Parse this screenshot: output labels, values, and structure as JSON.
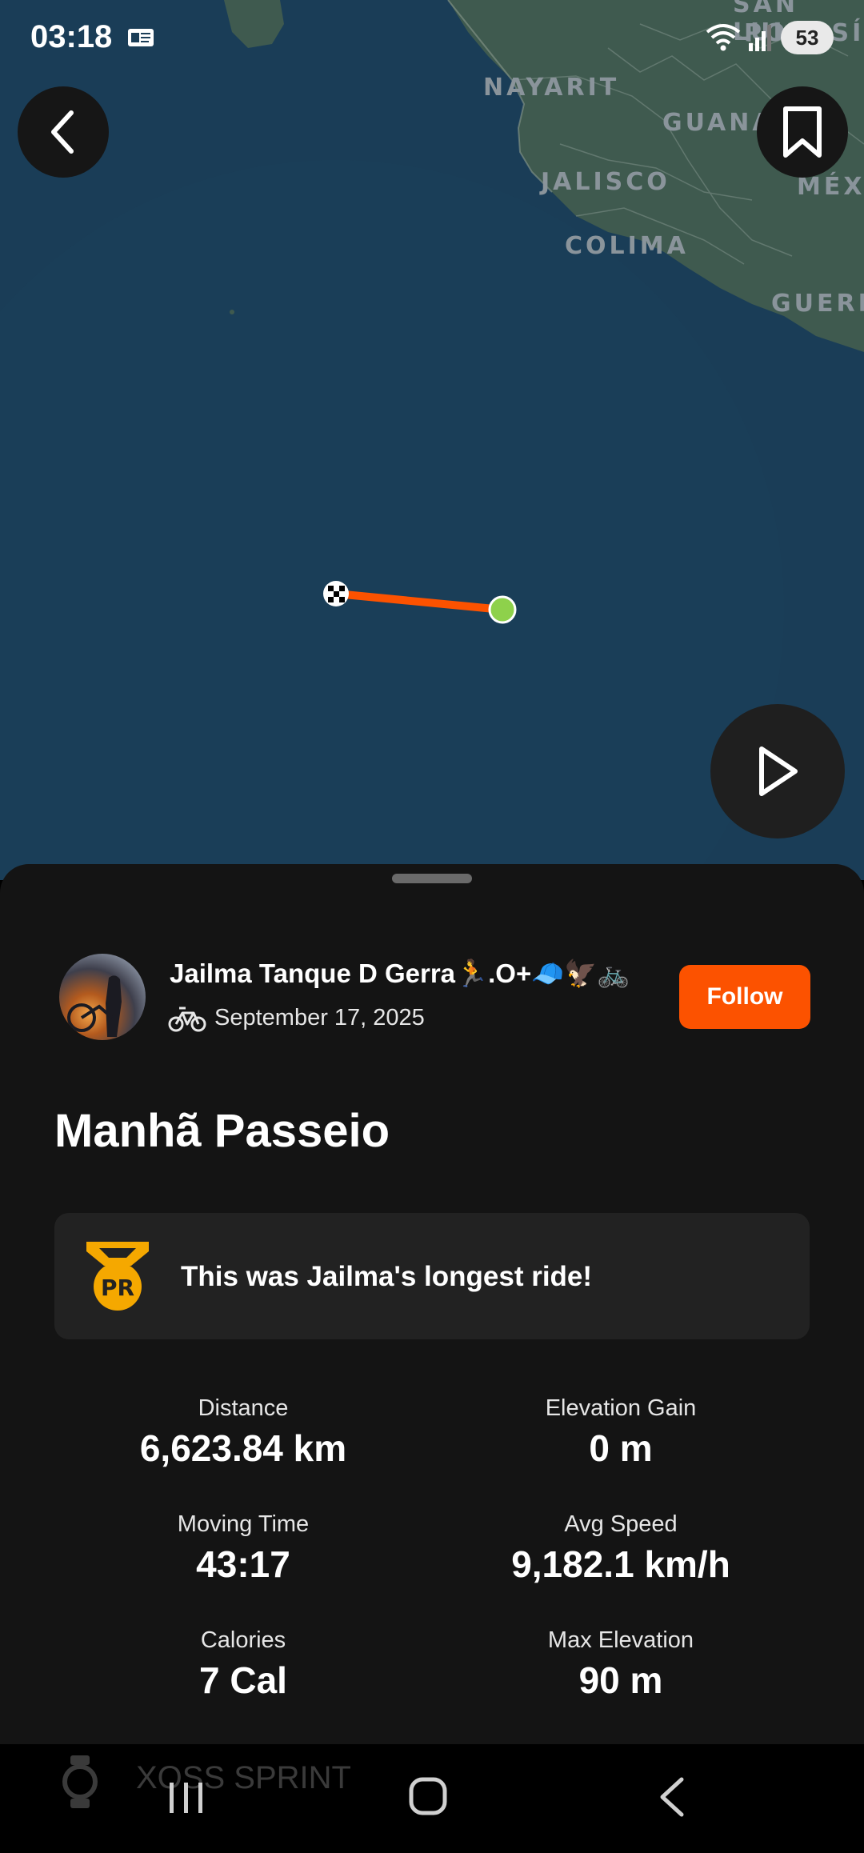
{
  "status_bar": {
    "time": "03:18",
    "battery": "53"
  },
  "map": {
    "labels": {
      "nayarit": "NAYARIT",
      "jalisco": "JALISCO",
      "colima": "COLIMA",
      "guanajuato": "GUANA",
      "mexico": "MÉX",
      "guerrero": "GUERR",
      "san_luis": "SAN LUIS",
      "potosi": "POTOSÍ"
    }
  },
  "activity": {
    "athlete_name": "Jailma Tanque  D Gerra🏃.O+🧢🦅🚲",
    "date": "September 17, 2025",
    "follow_label": "Follow",
    "title": "Manhã Passeio",
    "pr_message": "This was Jailma's longest ride!",
    "pr_badge": "PR"
  },
  "stats": {
    "distance": {
      "label": "Distance",
      "value": "6,623.84 km"
    },
    "elevation_gain": {
      "label": "Elevation Gain",
      "value": "0 m"
    },
    "moving_time": {
      "label": "Moving Time",
      "value": "43:17"
    },
    "avg_speed": {
      "label": "Avg Speed",
      "value": "9,182.1 km/h"
    },
    "calories": {
      "label": "Calories",
      "value": "7 Cal"
    },
    "max_elevation": {
      "label": "Max Elevation",
      "value": "90 m"
    }
  },
  "device": {
    "name": "XOSS SPRINT"
  },
  "colors": {
    "accent": "#fc5200",
    "route": "#fc5200",
    "end_marker": "#8ed14b",
    "sea": "#1a3d57",
    "land": "#3f5a4f"
  },
  "icons": [
    "notification-icon",
    "wifi-icon",
    "signal-icon",
    "back-arrow-icon",
    "bookmark-icon",
    "play-icon",
    "bike-icon",
    "pr-medal-icon",
    "watch-icon",
    "recents-icon",
    "home-icon",
    "nav-back-icon"
  ]
}
